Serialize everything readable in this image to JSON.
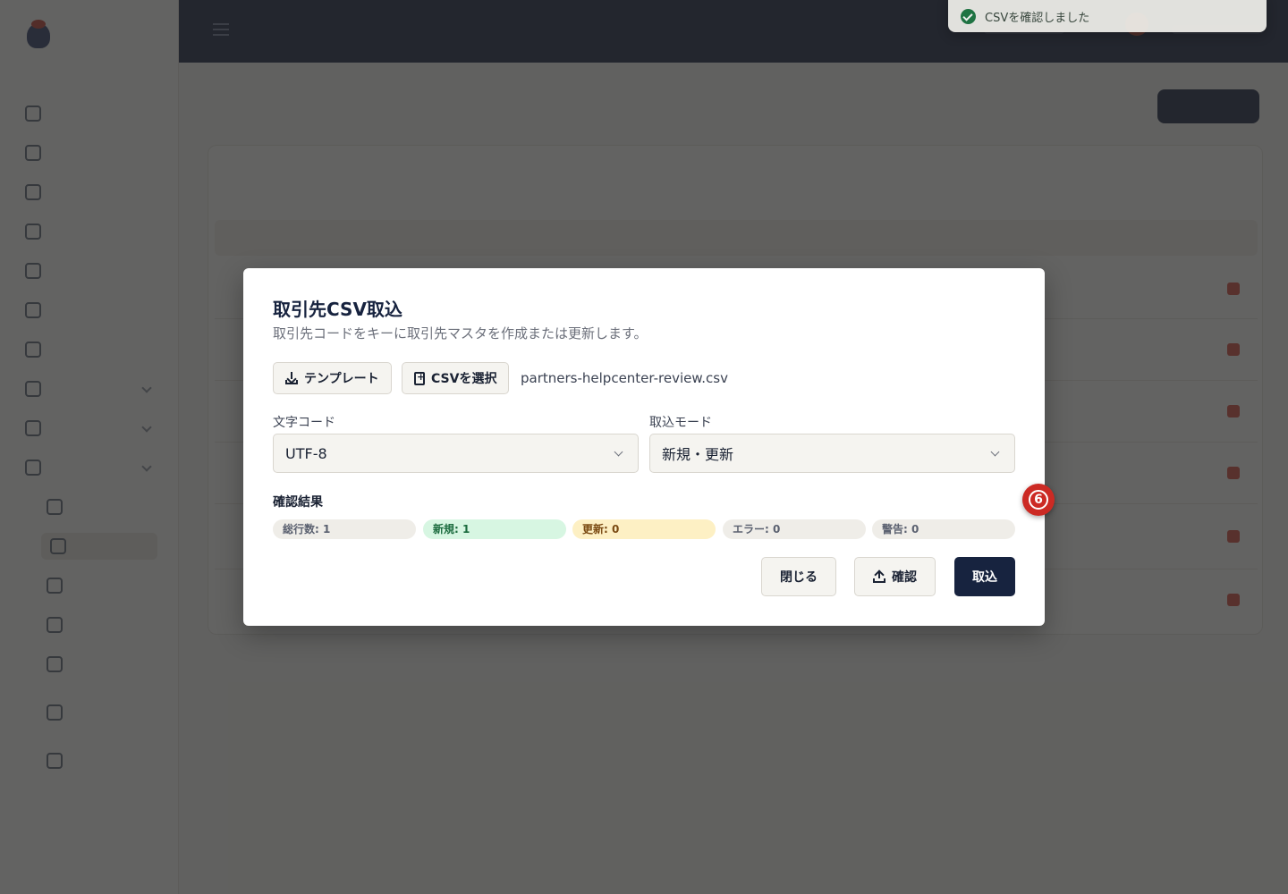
{
  "toast": {
    "message": "CSVを確認しました"
  },
  "modal": {
    "title": "取引先CSV取込",
    "description": "取引先コードをキーに取引先マスタを作成または更新します。",
    "template_button": "テンプレート",
    "select_csv_button": "CSVを選択",
    "file_name": "partners-helpcenter-review.csv",
    "encoding": {
      "label": "文字コード",
      "value": "UTF-8"
    },
    "mode": {
      "label": "取込モード",
      "value": "新規・更新"
    },
    "result": {
      "label": "確認結果",
      "badges": [
        "総行数: 1",
        "新規: 1",
        "更新: 0",
        "エラー: 0",
        "警告: 0"
      ]
    },
    "close_button": "閉じる",
    "check_button": "確認",
    "import_button": "取込"
  },
  "step_marker": "6",
  "colors": {
    "primary": "#17233f",
    "success": "#1f7a45",
    "marker": "#cc2a24"
  },
  "icons": [
    "check-circle-icon",
    "download-icon",
    "file-plus-icon",
    "upload-icon",
    "chevron-down-icon"
  ]
}
